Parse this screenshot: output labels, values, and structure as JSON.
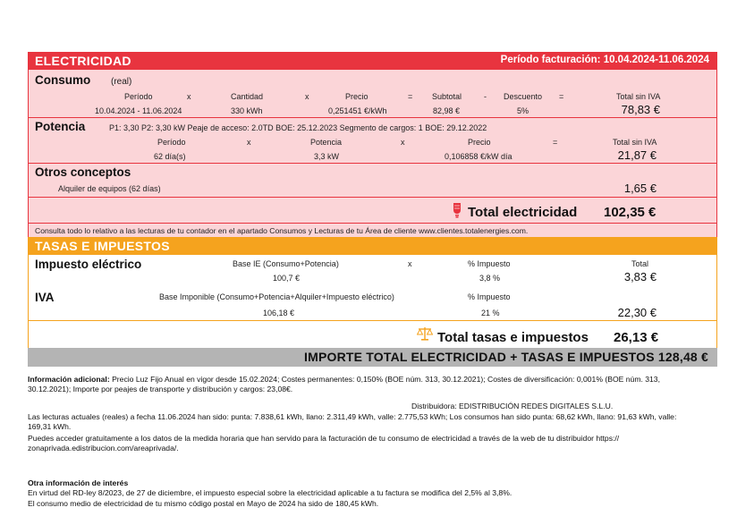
{
  "electricity": {
    "title": "ELECTRICIDAD",
    "period": "Período facturación: 10.04.2024-11.06.2024",
    "consumption": {
      "title": "Consumo",
      "type": "(real)",
      "headers": [
        "Período",
        "x",
        "Cantidad",
        "x",
        "Precio",
        "=",
        "Subtotal",
        "-",
        "Descuento",
        "=",
        "Total sin IVA"
      ],
      "period": "10.04.2024 - 11.06.2024",
      "quantity": "330 kWh",
      "price": "0,251451 €/kWh",
      "subtotal": "82,98 €",
      "discount": "5%",
      "total": "78,83 €"
    },
    "power": {
      "title": "Potencia",
      "details": "P1: 3,30 P2: 3,30 kW   Peaje de acceso: 2.0TD  BOE: 25.12.2023   Segmento de cargos: 1   BOE: 29.12.2022",
      "headers": [
        "Período",
        "x",
        "Potencia",
        "x",
        "Precio",
        "=",
        "Total sin IVA"
      ],
      "period": "62 día(s)",
      "power": "3,3 kW",
      "price": "0,106858 €/kW día",
      "total": "21,87 €"
    },
    "other": {
      "title": "Otros conceptos",
      "item": "Alquiler de equipos (62 días)",
      "total": "1,65 €"
    },
    "total_label": "Total electricidad",
    "total_value": "102,35 €",
    "note": "Consulta todo lo relativo a las lecturas de tu contador en el apartado Consumos y Lecturas de tu Área de cliente www.clientes.totalenergies.com."
  },
  "taxes": {
    "title": "TASAS E IMPUESTOS",
    "electric_tax": {
      "title": "Impuesto eléctrico",
      "base_label": "Base IE (Consumo+Potencia)",
      "x": "x",
      "pct_label": "% Impuesto",
      "total_label": "Total",
      "base": "100,7 €",
      "pct": "3,8 %",
      "total": "3,83 €"
    },
    "iva": {
      "title": "IVA",
      "base_label": "Base Imponible (Consumo+Potencia+Alquiler+Impuesto eléctrico)",
      "pct_label": "% Impuesto",
      "base": "106,18 €",
      "pct": "21 %",
      "total": "22,30 €"
    },
    "total_label": "Total tasas e impuestos",
    "total_value": "26,13 €"
  },
  "grand_total": "IMPORTE TOTAL ELECTRICIDAD + TASAS E IMPUESTOS 128,48 €",
  "info": {
    "additional_label": "Información adicional:",
    "additional_line1": "Precio Luz Fijo Anual en vigor desde 15.02.2024; Costes permanentes: 0,150% (BOE núm. 313, 30.12.2021); Costes de diversificación: 0,001% (BOE núm. 313,",
    "additional_line2": "30.12.2021); Importe por peajes de transporte y distribución y cargos: 23,08€.",
    "distributor": "Distribuidora: EDISTRIBUCIÓN REDES DIGITALES S.L.U.",
    "readings_line1": "Las lecturas actuales (reales) a fecha 11.06.2024 han sido: punta: 7.838,61 kWh, llano: 2.311,49 kWh, valle: 2.775,53 kWh; Los consumos han sido punta: 68,62 kWh, llano: 91,63 kWh, valle:",
    "readings_line2": "169,31 kWh.",
    "hourly_line1": "Puedes acceder gratuitamente a los datos de la medida horaria que han servido para la facturación de tu consumo de electricidad a través de la web de tu distribuidor https://",
    "hourly_line2": "zonaprivada.edistribucion.com/areaprivada/.",
    "interest_title": "Otra información de interés",
    "interest_line1": "En virtud del RD-ley 8/2023, de 27 de diciembre, el impuesto especial sobre la electricidad aplicable a tu factura se modifica del 2,5% al 3,8%.",
    "interest_line2": "El consumo medio de electricidad de tu mismo código postal en Mayo de 2024 ha sido de 180,45 kWh."
  },
  "colors": {
    "electricity": "#e8343f",
    "electricity_bg": "#fbd5d8",
    "taxes": "#f5a31e",
    "grand_bg": "#b4b4b4"
  }
}
